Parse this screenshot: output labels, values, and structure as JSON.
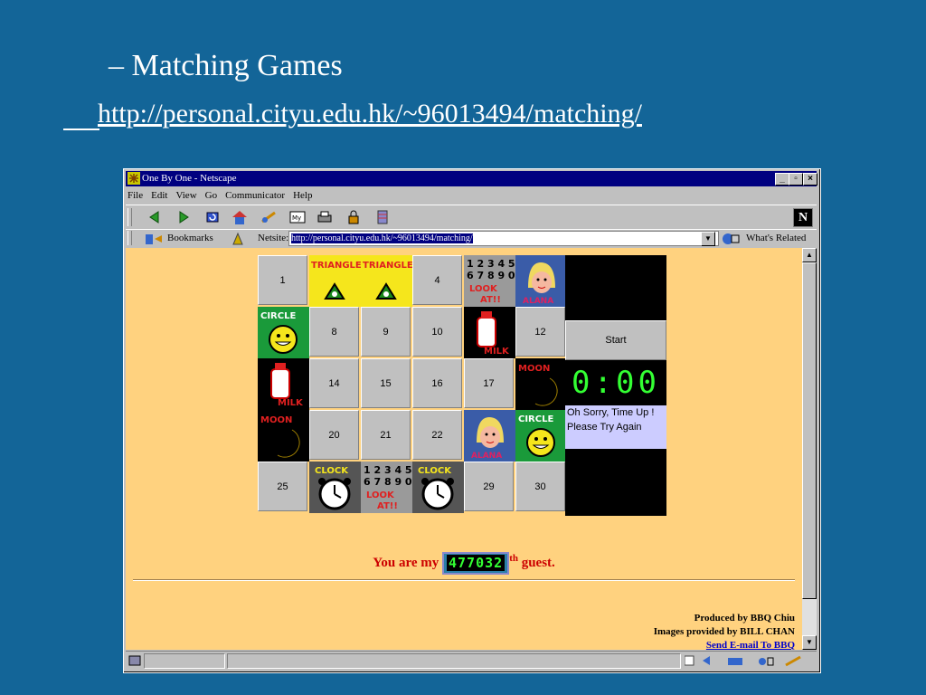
{
  "slide": {
    "title": "– Matching Games",
    "url": "http://personal.cityu.edu.hk/~96013494/matching/"
  },
  "window": {
    "title": "One By One - Netscape",
    "controls": [
      "minimize",
      "maximize",
      "close"
    ]
  },
  "menu": [
    "File",
    "Edit",
    "View",
    "Go",
    "Communicator",
    "Help"
  ],
  "toolbar": {
    "icons": [
      "back-icon",
      "forward-icon",
      "reload-icon",
      "home-icon",
      "search-icon",
      "my-netscape-icon",
      "print-icon",
      "security-icon",
      "stop-icon"
    ],
    "logo": "N"
  },
  "location": {
    "bookmarks_label": "Bookmarks",
    "netsite_label": "Netsite:",
    "value": "http://personal.cityu.edu.hk/~96013494/matching/",
    "related_label": "What's Related"
  },
  "game": {
    "cells": [
      {
        "kind": "num",
        "label": "1"
      },
      {
        "kind": "pic",
        "pic": "triangle",
        "text": "TRIANGLE"
      },
      {
        "kind": "pic",
        "pic": "triangle",
        "text": "TRIANGLE"
      },
      {
        "kind": "num",
        "label": "4"
      },
      {
        "kind": "pic",
        "pic": "numbers",
        "text": "12345 67890 LOOK AT!!"
      },
      {
        "kind": "pic",
        "pic": "face",
        "text": "ALANA"
      },
      {
        "kind": "pic",
        "pic": "circle",
        "text": "CIRCLE"
      },
      {
        "kind": "num",
        "label": "8"
      },
      {
        "kind": "num",
        "label": "9"
      },
      {
        "kind": "num",
        "label": "10"
      },
      {
        "kind": "pic",
        "pic": "milk",
        "text": "MILK"
      },
      {
        "kind": "num",
        "label": "12"
      },
      {
        "kind": "pic",
        "pic": "milk",
        "text": "MILK"
      },
      {
        "kind": "num",
        "label": "14"
      },
      {
        "kind": "num",
        "label": "15"
      },
      {
        "kind": "num",
        "label": "16"
      },
      {
        "kind": "num",
        "label": "17"
      },
      {
        "kind": "pic",
        "pic": "moon",
        "text": "MOON"
      },
      {
        "kind": "pic",
        "pic": "moon",
        "text": "MOON"
      },
      {
        "kind": "num",
        "label": "20"
      },
      {
        "kind": "num",
        "label": "21"
      },
      {
        "kind": "num",
        "label": "22"
      },
      {
        "kind": "pic",
        "pic": "face",
        "text": "ALANA"
      },
      {
        "kind": "pic",
        "pic": "circle",
        "text": "CIRCLE"
      },
      {
        "kind": "num",
        "label": "25"
      },
      {
        "kind": "pic",
        "pic": "clock",
        "text": "CLOCK"
      },
      {
        "kind": "pic",
        "pic": "numbers",
        "text": "12345 67890 LOOK AT!!"
      },
      {
        "kind": "pic",
        "pic": "clock",
        "text": "CLOCK"
      },
      {
        "kind": "num",
        "label": "29"
      },
      {
        "kind": "num",
        "label": "30"
      }
    ],
    "start_label": "Start",
    "timer": "0:00",
    "message_line1": "Oh Sorry, Time Up !",
    "message_line2": "Please Try Again"
  },
  "guest": {
    "prefix": "You are my",
    "count": "477032",
    "suffix_sup": "th",
    "suffix": "guest."
  },
  "credits": {
    "produced": "Produced by BBQ Chiu",
    "images": "Images provided by BILL CHAN",
    "email": "Send E-mail To BBQ"
  }
}
